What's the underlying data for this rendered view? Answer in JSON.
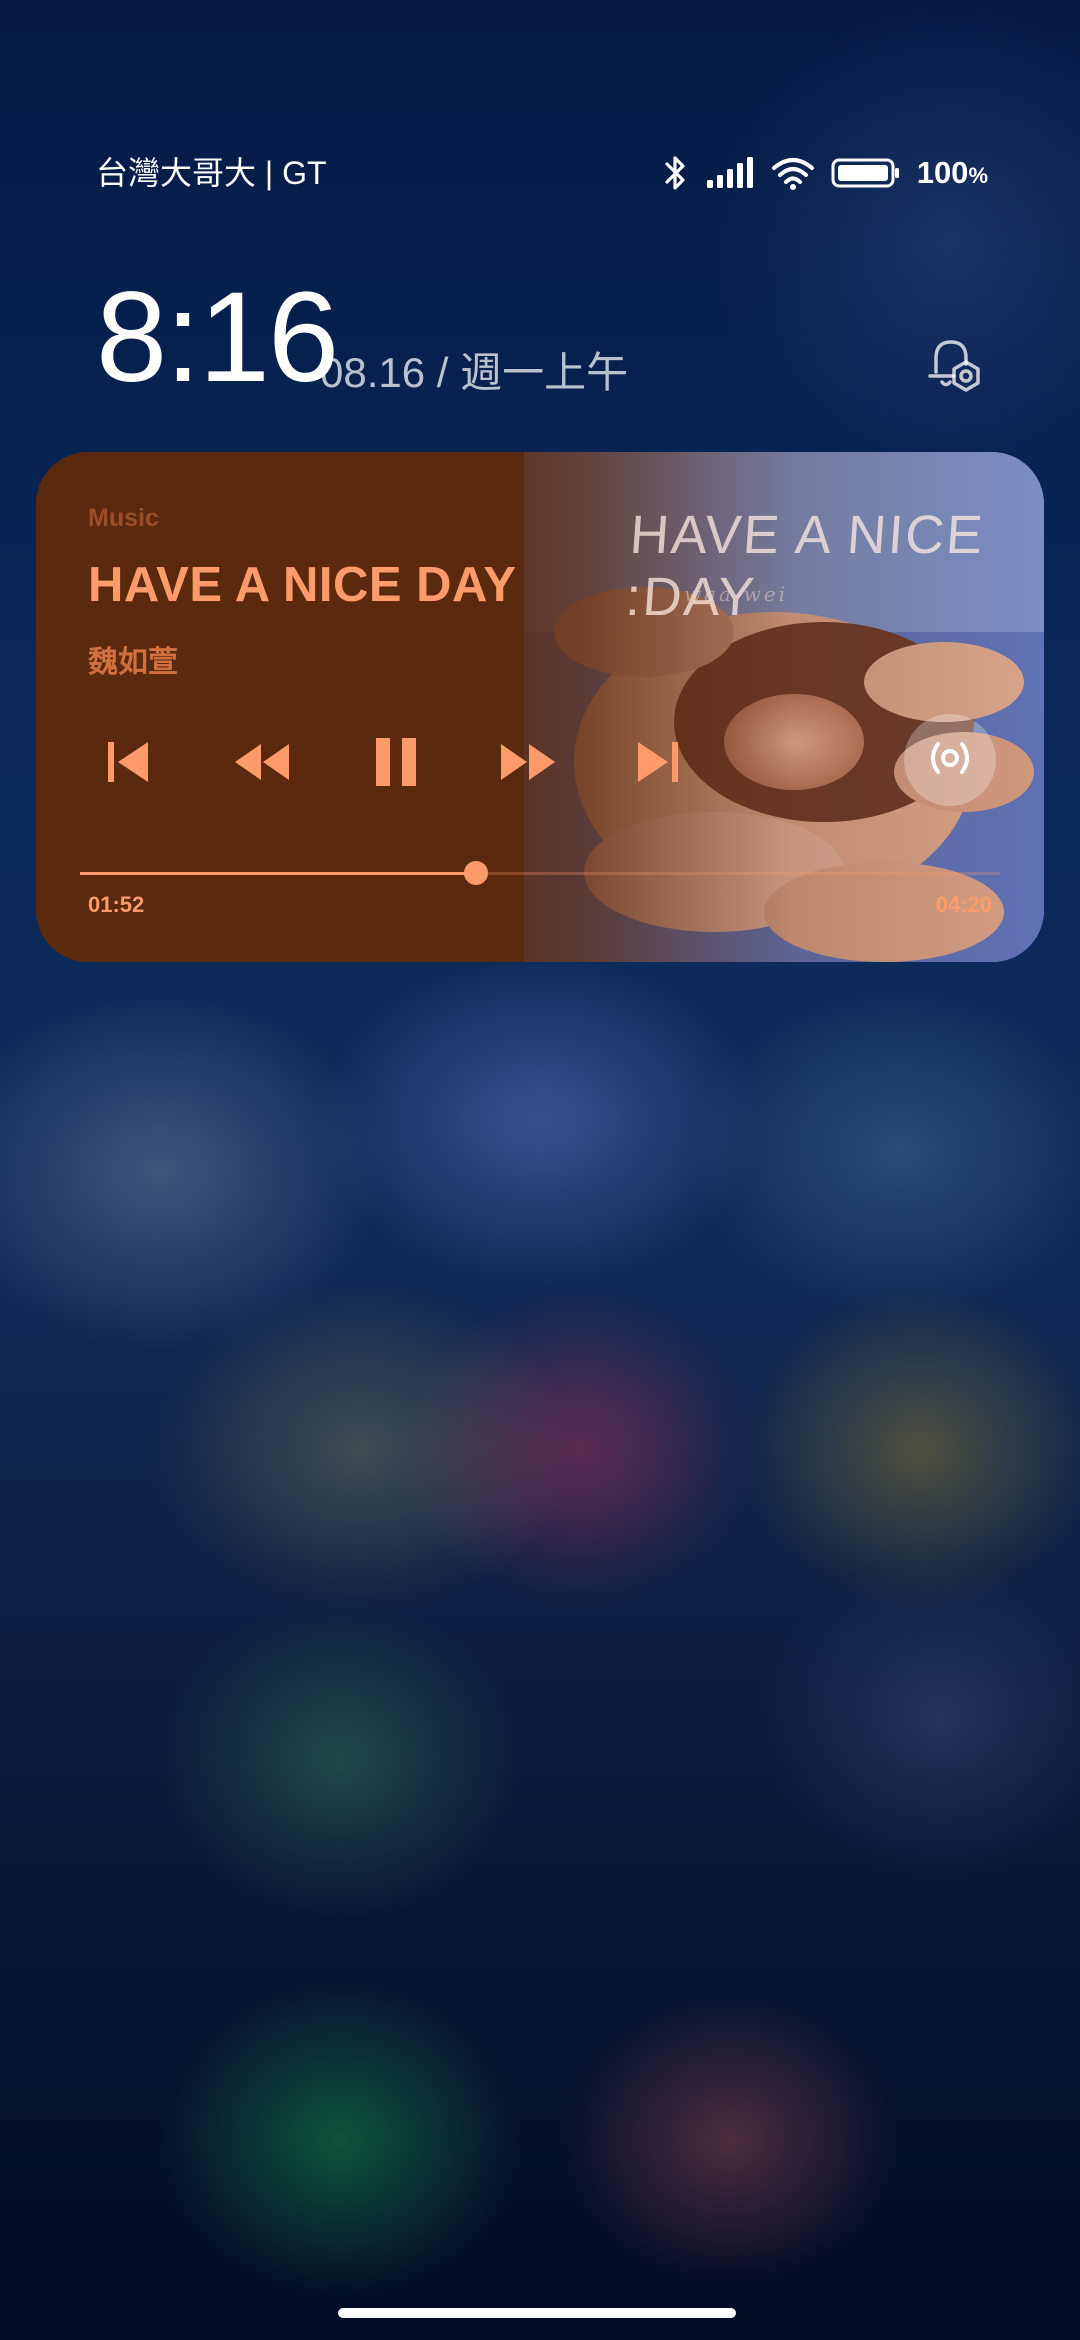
{
  "status_bar": {
    "carrier": "台灣大哥大 | GT",
    "battery": "100",
    "battery_unit": "%",
    "icons": [
      "bluetooth-icon",
      "signal-icon",
      "wifi-icon",
      "battery-icon"
    ]
  },
  "lockscreen": {
    "time": "8:16",
    "date": "08.16 / 週一上午",
    "settings_icon": "lock-screen-settings-icon"
  },
  "music": {
    "source": "Music",
    "title": "HAVE A NICE DAY",
    "artist": "魏如萱",
    "album_art_text": "HAVE A NICE :DAY",
    "album_art_signature": "waa-wei",
    "elapsed": "01:52",
    "duration": "04:20",
    "progress": 0.43,
    "state": "playing",
    "accent_color": "#ff9a6a",
    "controls": [
      "previous-track-icon",
      "rewind-icon",
      "pause-icon",
      "fast-forward-icon",
      "next-track-icon",
      "cast-icon"
    ]
  },
  "colors": {
    "card_background": "#5a290e",
    "accent": "#ff9a6a",
    "artist_text": "#d0703f",
    "source_text": "#9a4f2a"
  }
}
